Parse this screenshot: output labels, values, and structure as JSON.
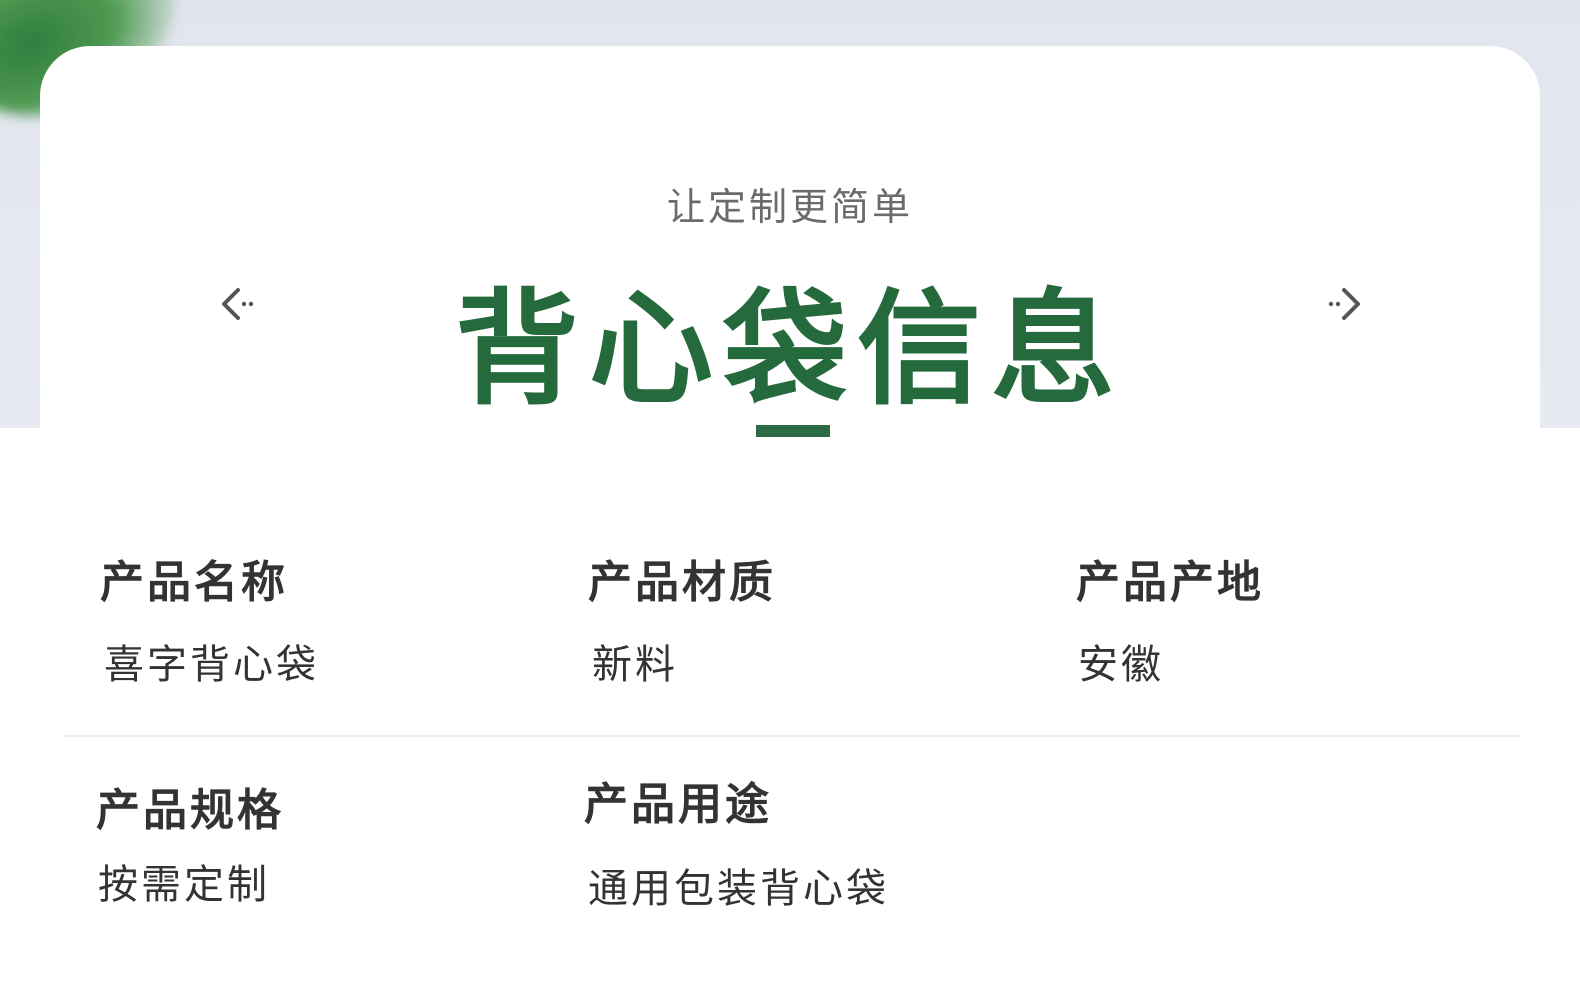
{
  "header": {
    "subtitle": "让定制更简单",
    "title": "背心袋信息"
  },
  "fields": [
    {
      "label": "产品名称",
      "value": "喜字背心袋"
    },
    {
      "label": "产品材质",
      "value": "新料"
    },
    {
      "label": "产品产地",
      "value": "安徽"
    },
    {
      "label": "产品规格",
      "value": "按需定制"
    },
    {
      "label": "产品用途",
      "value": "通用包装背心袋"
    }
  ],
  "colors": {
    "accent_green": "#256a3c",
    "text": "#333333",
    "subtitle": "#6b6b6b",
    "background_top": "#e1e5ee"
  },
  "icons": {
    "prev": "arrow-left-icon",
    "next": "arrow-right-icon",
    "decoration": "leaf-icon"
  }
}
